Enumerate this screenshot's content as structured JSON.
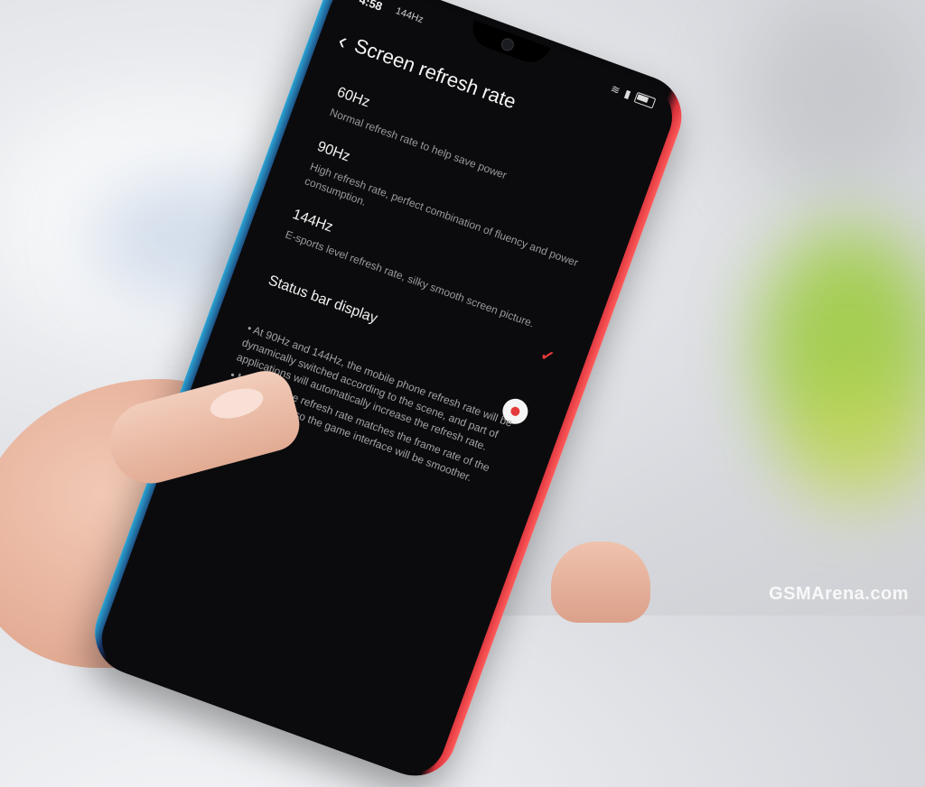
{
  "status_bar": {
    "time": "4:58",
    "extra": "144Hz"
  },
  "header": {
    "title": "Screen refresh rate"
  },
  "options": [
    {
      "label": "60Hz",
      "description": "Normal refresh rate to help save power"
    },
    {
      "label": "90Hz",
      "description": "High refresh rate, perfect combination of fluency and power consumption."
    },
    {
      "label": "144Hz",
      "description": "E-sports level refresh rate, silky smooth screen picture."
    }
  ],
  "status_bar_display": {
    "label": "Status bar display",
    "enabled": true
  },
  "notes": [
    "• At 90Hz and 144Hz, the mobile phone refresh rate will be dynamically switched according to the scene, and part of applications will automatically increase the refresh rate.",
    "• Mobile phone refresh rate matches the frame rate of the game settings, so the game interface will be smoother."
  ],
  "selected_option_index": 2,
  "colors": {
    "accent": "#e43a3a",
    "screen_bg": "#0b0b0d"
  },
  "watermark": "GSMArena.com"
}
